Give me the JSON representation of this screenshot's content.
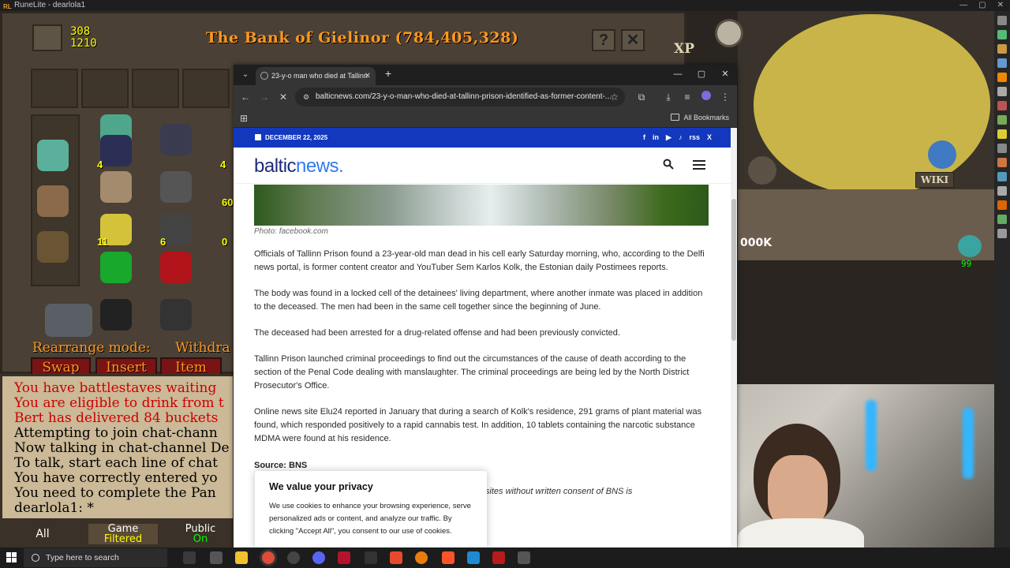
{
  "runelite": {
    "title": "RuneLite - dearlola1",
    "bank": {
      "title": "The Bank of Gielinor (784,405,328)",
      "count_top": "308",
      "count_bottom": "1210",
      "help_label": "?",
      "close_label": "✕",
      "rearrange_label": "Rearrange mode:",
      "withdraw_label": "Withdra",
      "swap_label": "Swap",
      "insert_label": "Insert",
      "item_label": "Item",
      "item_counts": [
        "4",
        "4",
        "60",
        "11",
        "6",
        "0"
      ]
    },
    "chat": {
      "lines": [
        {
          "text": "You have battlestaves waiting",
          "color": "#cc0000"
        },
        {
          "text": "You are eligible to drink from t",
          "color": "#cc0000"
        },
        {
          "text": "Bert has delivered 84 buckets",
          "color": "#cc0000"
        },
        {
          "text": "Attempting to join chat-chann",
          "color": "#000000"
        },
        {
          "text": "Now talking in chat-channel De",
          "color": "#000000"
        },
        {
          "text": "To talk, start each line of chat",
          "color": "#000000"
        },
        {
          "text": "You have correctly entered yo",
          "color": "#000000"
        },
        {
          "text": "You need to complete the Pan",
          "color": "#000000"
        },
        {
          "text": "dearlola1: *",
          "color": "#000000"
        }
      ],
      "tabs": [
        {
          "line1": "All",
          "line2": ""
        },
        {
          "line1": "Game",
          "line2": "Filtered"
        },
        {
          "line1": "Public",
          "line2": "On"
        }
      ]
    },
    "xp_label": "XP",
    "wiki_label": "WIKI",
    "k_label": "000K",
    "hp_value": "99"
  },
  "browser": {
    "tab_title": "23-y-o man who died at Tallinn",
    "url": "balticnews.com/23-y-o-man-who-died-at-tallinn-prison-identified-as-former-content-...",
    "bookmarks_label": "All Bookmarks",
    "page": {
      "date": "DECEMBER 22, 2025",
      "social_icons": [
        "f",
        "in",
        "▶",
        "♪",
        "rss",
        "X"
      ],
      "logo_part1": "baltic",
      "logo_part2": "news.",
      "photo_caption": "Photo: facebook.com",
      "paragraphs": [
        "Officials of Tallinn Prison found a 23-year-old man dead in his cell early Saturday morning, who, according to the Delfi news portal, is former content creator and YouTuber Sem Karlos Kolk, the Estonian daily Postimees reports.",
        "The body was found in a locked cell of the detainees' living department, where another inmate was placed in addition to the deceased. The men had been in the same cell together since the beginning of June.",
        "The deceased had been arrested for a drug-related offense and had been previously convicted.",
        "Tallinn Prison launched criminal proceedings to find out the circumstances of the cause of death according to the section of the Penal Code dealing with manslaughter. The criminal proceedings are being led by the North District Prosecutor's Office.",
        "Online news site Elu24 reported in January that during a search of Kolk's residence, 291 grams of plant material was found, which responded positively to a rapid cannabis test. In addition, 10 tablets containing the narcotic substance MDMA were found at his residence."
      ],
      "source": "Source: BNS",
      "notice_fragment": "r websites without written consent of BNS is",
      "privacy": {
        "title": "We value your privacy",
        "body": "We use cookies to enhance your browsing experience, serve personalized ads or content, and analyze our traffic. By clicking \"Accept All\", you consent to our use of cookies."
      }
    }
  },
  "taskbar": {
    "search_placeholder": "Type here to search"
  }
}
